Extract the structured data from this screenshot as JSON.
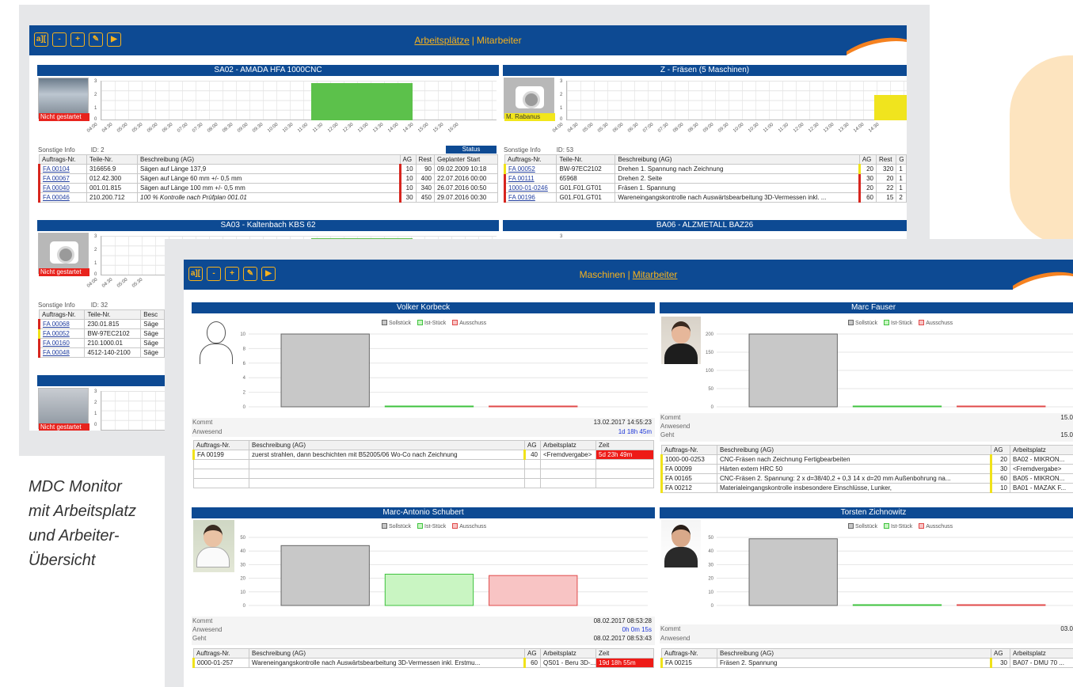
{
  "caption": {
    "lines": [
      "MDC Monitor",
      "mit Arbeitsplatz",
      "und Arbeiter-",
      "Übersicht"
    ]
  },
  "toolbar": {
    "icons": [
      "text-size-icon",
      "minus-icon",
      "plus-icon",
      "edit-icon",
      "play-icon"
    ],
    "icon_glyphs": [
      "a][",
      "-",
      "+",
      "✎",
      "▶"
    ]
  },
  "back_screen": {
    "nav": {
      "link1": "Arbeitsplätze",
      "sep": "|",
      "link2": "Mitarbeiter"
    },
    "machines": [
      {
        "title": "SA02 - AMADA HFA 1000CNC",
        "status": "Nicht gestartet",
        "info_label": "Sonstige Info",
        "id": "ID: 2",
        "status_chip": "Status",
        "yticks": [
          "3",
          "2",
          "1",
          "0"
        ],
        "xticks": [
          "04:00",
          "04:30",
          "05:00",
          "05:30",
          "06:00",
          "06:30",
          "07:00",
          "07:30",
          "08:00",
          "08:30",
          "09:00",
          "09:30",
          "10:00",
          "10:30",
          "11:00",
          "11:30",
          "12:00",
          "12:30",
          "13:00",
          "13:30",
          "14:00",
          "14:30",
          "15:00",
          "15:30",
          "16:00"
        ],
        "headers": [
          "Auftrags-Nr.",
          "Teile-Nr.",
          "Beschreibung (AG)",
          "AG",
          "Rest",
          "Geplanter Start"
        ],
        "rows": [
          [
            "FA 00104",
            "316656.9",
            "Sägen auf Länge 137,9",
            "10",
            "90",
            "09.02.2009 10:18"
          ],
          [
            "FA 00067",
            "012.42.300",
            "Sägen auf Länge 60 mm +/- 0,5 mm",
            "10",
            "400",
            "22.07.2016 00:00"
          ],
          [
            "FA 00040",
            "001.01.815",
            "Sägen auf Länge 100 mm +/- 0,5 mm",
            "10",
            "340",
            "26.07.2016 00:50"
          ],
          [
            "FA 00046",
            "210.200.712",
            "100 % Kontrolle nach Prüfplan 001.01",
            "30",
            "450",
            "29.07.2016 00:30"
          ]
        ]
      },
      {
        "title": "Z - Fräsen (5 Maschinen)",
        "status": "M. Rabanus",
        "info_label": "Sonstige Info",
        "id": "ID: 53",
        "yticks": [
          "3",
          "2",
          "1",
          "0"
        ],
        "xticks": [
          "04:00",
          "04:30",
          "05:00",
          "05:30",
          "06:00",
          "06:30",
          "07:00",
          "07:30",
          "08:00",
          "08:30",
          "09:00",
          "09:30",
          "10:00",
          "10:30",
          "11:00",
          "11:30",
          "12:00",
          "12:30",
          "13:00",
          "13:30",
          "14:00",
          "14:30"
        ],
        "headers": [
          "Auftrags-Nr.",
          "Teile-Nr.",
          "Beschreibung (AG)",
          "AG",
          "Rest",
          "G"
        ],
        "rows": [
          [
            "FA 00052",
            "BW-97EC2102",
            "Drehen 1. Spannung nach Zeichnung",
            "20",
            "320",
            "1"
          ],
          [
            "FA 00111",
            "65968",
            "Drehen 2. Seite",
            "30",
            "20",
            "1"
          ],
          [
            "1000-01-0246",
            "G01.F01.GT01",
            "Fräsen 1. Spannung",
            "20",
            "22",
            "1"
          ],
          [
            "FA 00196",
            "G01.F01.GT01",
            "Wareneingangskontrolle nach Auswärtsbearbeitung 3D-Vermessen inkl. ...",
            "60",
            "15",
            "2"
          ]
        ]
      },
      {
        "title": "SA03 - Kaltenbach KBS 62",
        "status": "Nicht gestartet",
        "info_label": "Sonstige Info",
        "id": "ID: 32",
        "yticks": [
          "3",
          "2",
          "1",
          "0"
        ],
        "xticks": [
          "04:00",
          "04:30",
          "05:00",
          "05:30"
        ],
        "headers": [
          "Auftrags-Nr.",
          "Teile-Nr.",
          "Besc"
        ],
        "rows": [
          [
            "FA 00068",
            "230.01.815",
            "Säge"
          ],
          [
            "FA 00052",
            "BW-97EC2102",
            "Säge"
          ],
          [
            "FA 00160",
            "210.1000.01",
            "Säge"
          ],
          [
            "FA 00048",
            "4512-140-2100",
            "Säge"
          ]
        ]
      },
      {
        "title": "BA06 - ALZMETALL BAZ26",
        "yticks": [
          "3"
        ]
      },
      {
        "title": "",
        "status": "Nicht gestartet",
        "yticks": [
          "3",
          "2",
          "1",
          "0"
        ]
      }
    ]
  },
  "front_screen": {
    "nav": {
      "link1": "Maschinen",
      "sep": "|",
      "link2": "Mitarbeiter"
    },
    "legend": [
      "Sollstück",
      "Ist-Stück",
      "Ausschuss"
    ],
    "colors": {
      "soll": "#c8c8c8",
      "ist": "#c9f5c2",
      "ausschuss": "#f8c4c4",
      "soll_border": "#666666",
      "ist_border": "#3ec23e",
      "ausschuss_border": "#e04a4a"
    },
    "employees": [
      {
        "name": "Volker Korbeck",
        "yticks": [
          "10",
          "8",
          "6",
          "4",
          "2",
          "0"
        ],
        "ymax": 10,
        "soll": 10,
        "ist": 0,
        "ausschuss": 0,
        "kommt_label": "Kommt",
        "kommt": "13.02.2017 14:55:23",
        "anwesend_label": "Anwesend",
        "anwesend": "1d 18h 45m",
        "headers": [
          "Auftrags-Nr.",
          "Beschreibung (AG)",
          "AG",
          "Arbeitsplatz",
          "Zeit"
        ],
        "rows": [
          [
            "FA 00199",
            "zuerst strahlen, dann beschichten mit B52005/06 Wo-Co nach Zeichnung",
            "40",
            "<Fremdvergabe>",
            "5d 23h 49m"
          ]
        ]
      },
      {
        "name": "Marc Fauser",
        "yticks": [
          "200",
          "150",
          "100",
          "50",
          "0"
        ],
        "ymax": 200,
        "soll": 200,
        "ist": 0,
        "ausschuss": 0,
        "kommt_label": "Kommt",
        "kommt": "15.0",
        "anwesend_label": "Anwesend",
        "geht_label": "Geht",
        "geht": "15.0",
        "headers": [
          "Auftrags-Nr.",
          "Beschreibung (AG)",
          "AG",
          "Arbeitsplatz"
        ],
        "rows": [
          [
            "1000-00-0253",
            "CNC-Fräsen nach Zeichnung Fertigbearbeiten",
            "20",
            "BA02 - MIKRON..."
          ],
          [
            "FA 00099",
            "Härten extern HRC 50",
            "30",
            "<Fremdvergabe>"
          ],
          [
            "FA 00165",
            "CNC-Fräsen 2. Spannung: 2 x d=38/40,2 + 0,3 14 x d=20 mm Außenbohrung na...",
            "60",
            "BA05 - MIKRON..."
          ],
          [
            "FA 00212",
            "Materialeingangskontrolle insbesondere Einschlüsse, Lunker,",
            "10",
            "BA01 - MAZAK F..."
          ]
        ]
      },
      {
        "name": "Marc-Antonio Schubert",
        "yticks": [
          "50",
          "40",
          "30",
          "20",
          "10",
          "0"
        ],
        "ymax": 50,
        "soll": 44,
        "ist": 23,
        "ausschuss": 22,
        "kommt_label": "Kommt",
        "kommt": "08.02.2017 08:53:28",
        "anwesend_label": "Anwesend",
        "anwesend": "0h 0m 15s",
        "geht_label": "Geht",
        "geht": "08.02.2017 08:53:43",
        "headers": [
          "Auftrags-Nr.",
          "Beschreibung (AG)",
          "AG",
          "Arbeitsplatz",
          "Zeit"
        ],
        "rows": [
          [
            "0000-01-257",
            "Wareneingangskontrolle nach Auswärtsbearbeitung 3D-Vermessen inkl. Erstmu...",
            "60",
            "QS01 - Beru 3D-...",
            "19d 18h 55m"
          ]
        ]
      },
      {
        "name": "Torsten Zichnowitz",
        "yticks": [
          "50",
          "40",
          "30",
          "20",
          "10",
          "0"
        ],
        "ymax": 50,
        "soll": 49,
        "ist": 0,
        "ausschuss": 0,
        "kommt_label": "Kommt",
        "kommt": "03.0",
        "anwesend_label": "Anwesend",
        "headers": [
          "Auftrags-Nr.",
          "Beschreibung (AG)",
          "AG",
          "Arbeitsplatz"
        ],
        "rows": [
          [
            "FA 00215",
            "Fräsen 2. Spannung",
            "30",
            "BA07 - DMU 70 ..."
          ]
        ]
      }
    ]
  }
}
